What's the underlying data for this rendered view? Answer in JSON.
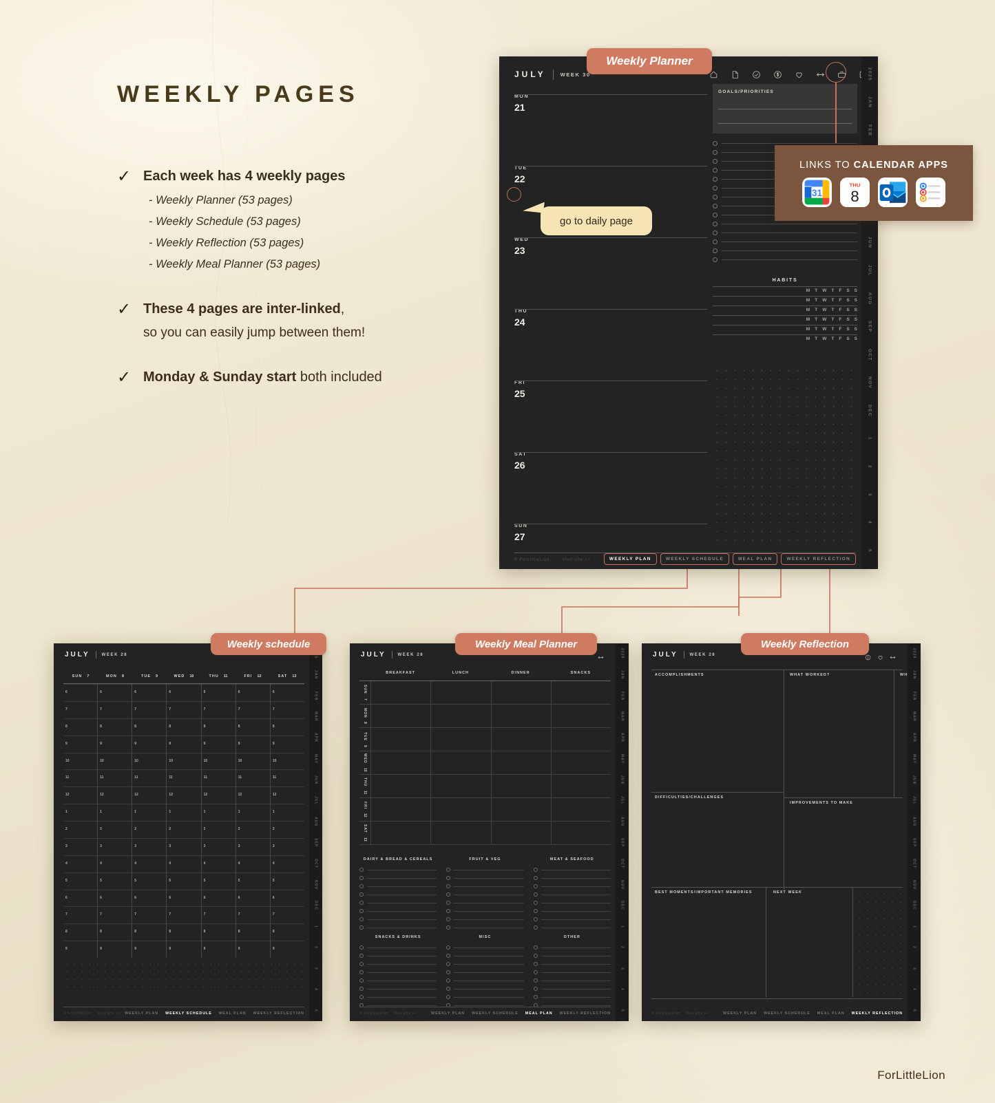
{
  "page": {
    "title": "WEEKLY PAGES",
    "brand": "ForLittleLion",
    "accent": "#c4705a",
    "bubble_color": "#cf7b61",
    "paper_color": "#efe7d2",
    "page_color": "#232323"
  },
  "bullets": [
    {
      "tick": "check-icon",
      "text": "Each week has 4 weekly pages",
      "sub": [
        "- Weekly Planner (53 pages)",
        "- Weekly Schedule (53 pages)",
        "- Weekly Reflection (53 pages)",
        "- Weekly Meal Planner (53 pages)"
      ]
    },
    {
      "tick": "check-icon",
      "text": "These 4 pages are inter-linked",
      "text_tail": ",",
      "second_line": "so you can easily jump between them!"
    },
    {
      "tick": "check-icon",
      "text": "Monday & Sunday start",
      "text_tail": " both included"
    }
  ],
  "callouts": {
    "weekly_planner": "Weekly Planner",
    "weekly_schedule": "Weekly schedule",
    "weekly_meal_planner": "Weekly Meal Planner",
    "weekly_reflection": "Weekly Reflection",
    "go_to_daily": "go to daily page"
  },
  "calendar_apps": {
    "title_light": "LINKS TO ",
    "title_bold": "CALENDAR APPS",
    "apps": [
      {
        "name": "google-calendar-icon",
        "label": "31"
      },
      {
        "name": "apple-calendar-icon",
        "label": "8",
        "weekday": "THU"
      },
      {
        "name": "outlook-icon",
        "label": "O"
      },
      {
        "name": "apple-reminders-icon",
        "label": ""
      }
    ]
  },
  "weekly_planner": {
    "month": "JULY",
    "week": "WEEK 30",
    "toolbar_icons": [
      "home-icon",
      "page-icon",
      "check-circle-icon",
      "dollar-circle-icon",
      "heart-icon",
      "arrows-horizontal-icon",
      "briefcase-icon",
      "external-link-icon"
    ],
    "days": [
      {
        "abbr": "MON",
        "num": "21"
      },
      {
        "abbr": "TUE",
        "num": "22",
        "highlighted": true
      },
      {
        "abbr": "WED",
        "num": "23"
      },
      {
        "abbr": "THU",
        "num": "24"
      },
      {
        "abbr": "FRI",
        "num": "25"
      },
      {
        "abbr": "SAT",
        "num": "26"
      },
      {
        "abbr": "SUN",
        "num": "27"
      }
    ],
    "goals_label": "GOALS/PRIORITIES",
    "checklist_rows": 14,
    "habits_label": "HABITS",
    "habit_days": [
      "M",
      "T",
      "W",
      "T",
      "F",
      "S",
      "S"
    ],
    "habit_rows": 6,
    "credit": "© ForLittleLion.",
    "visit": "Visit site >>",
    "nav_tabs": [
      {
        "label": "WEEKLY PLAN",
        "active": true
      },
      {
        "label": "WEEKLY SCHEDULE",
        "active": false
      },
      {
        "label": "MEAL PLAN",
        "active": false
      },
      {
        "label": "WEEKLY REFLECTION",
        "active": false
      }
    ],
    "rail": [
      "2025",
      "JAN",
      "FEB",
      "MAR",
      "APR",
      "MAY",
      "JUN",
      "JUL",
      "AUG",
      "SEP",
      "OCT",
      "NOV",
      "DEC",
      "1",
      "2",
      "3",
      "4",
      "5"
    ]
  },
  "weekly_schedule": {
    "month": "JULY",
    "week": "WEEK 28",
    "days": [
      {
        "abbr": "SUN",
        "num": "7"
      },
      {
        "abbr": "MON",
        "num": "8"
      },
      {
        "abbr": "TUE",
        "num": "9"
      },
      {
        "abbr": "WED",
        "num": "10"
      },
      {
        "abbr": "THU",
        "num": "11"
      },
      {
        "abbr": "FRI",
        "num": "12"
      },
      {
        "abbr": "SAT",
        "num": "13"
      }
    ],
    "hours": [
      "6",
      "7",
      "8",
      "9",
      "10",
      "11",
      "12",
      "1",
      "2",
      "3",
      "4",
      "5",
      "6",
      "7",
      "8",
      "9"
    ],
    "credit": "© ForLittleLion.",
    "visit": "Visit site >>",
    "nav_tabs": [
      {
        "label": "WEEKLY PLAN",
        "active": false
      },
      {
        "label": "WEEKLY SCHEDULE",
        "active": true
      },
      {
        "label": "MEAL PLAN",
        "active": false
      },
      {
        "label": "WEEKLY REFLECTION",
        "active": false
      }
    ],
    "rail": [
      "2025",
      "JAN",
      "FEB",
      "MAR",
      "APR",
      "MAY",
      "JUN",
      "JUL",
      "AUG",
      "SEP",
      "OCT",
      "NOV",
      "DEC",
      "1",
      "2",
      "3",
      "4",
      "5"
    ]
  },
  "meal_planner": {
    "month": "JULY",
    "week": "WEEK 28",
    "columns": [
      "BREAKFAST",
      "LUNCH",
      "DINNER",
      "SNACKS"
    ],
    "days": [
      {
        "abbr": "SUN",
        "num": "7"
      },
      {
        "abbr": "MON",
        "num": "8"
      },
      {
        "abbr": "TUE",
        "num": "9"
      },
      {
        "abbr": "WED",
        "num": "10"
      },
      {
        "abbr": "THU",
        "num": "11"
      },
      {
        "abbr": "FRI",
        "num": "12"
      },
      {
        "abbr": "SAT",
        "num": "13"
      }
    ],
    "list_groups": [
      [
        "DAIRY & BREAD & CEREALS",
        "FRUIT & VEG",
        "MEAT & SEAFOOD"
      ],
      [
        "SNACKS & DRINKS",
        "MISC",
        "OTHER"
      ]
    ],
    "list_rows": 8,
    "credit": "© ForLittleLion.",
    "visit": "Visit site >>",
    "nav_tabs": [
      {
        "label": "WEEKLY PLAN",
        "active": false
      },
      {
        "label": "WEEKLY SCHEDULE",
        "active": false
      },
      {
        "label": "MEAL PLAN",
        "active": true
      },
      {
        "label": "WEEKLY REFLECTION",
        "active": false
      }
    ],
    "rail": [
      "2025",
      "JAN",
      "FEB",
      "MAR",
      "APR",
      "MAY",
      "JUN",
      "JUL",
      "AUG",
      "SEP",
      "OCT",
      "NOV",
      "DEC",
      "1",
      "2",
      "3",
      "4",
      "5"
    ]
  },
  "weekly_reflection": {
    "month": "JULY",
    "week": "WEEK 28",
    "toolbar_icons": [
      "dollar-circle-icon",
      "heart-icon",
      "arrows-horizontal-icon"
    ],
    "sections": [
      "ACCOMPLISHMENTS",
      "WHAT WORKED?",
      "WHAT DIDN'T WORK?",
      "DIFFICULTIES/CHALLENGES",
      "IMPROVEMENTS TO MAKE",
      "BEST MOMENTS/IMPORTANT MEMORIES",
      "NEXT WEEK"
    ],
    "credit": "© ForLittleLion.",
    "visit": "Visit site >>",
    "nav_tabs": [
      {
        "label": "WEEKLY PLAN",
        "active": false
      },
      {
        "label": "WEEKLY SCHEDULE",
        "active": false
      },
      {
        "label": "MEAL PLAN",
        "active": false
      },
      {
        "label": "WEEKLY REFLECTION",
        "active": true
      }
    ],
    "rail": [
      "2025",
      "JAN",
      "FEB",
      "MAR",
      "APR",
      "MAY",
      "JUN",
      "JUL",
      "AUG",
      "SEP",
      "OCT",
      "NOV",
      "DEC",
      "1",
      "2",
      "3",
      "4",
      "5"
    ]
  }
}
